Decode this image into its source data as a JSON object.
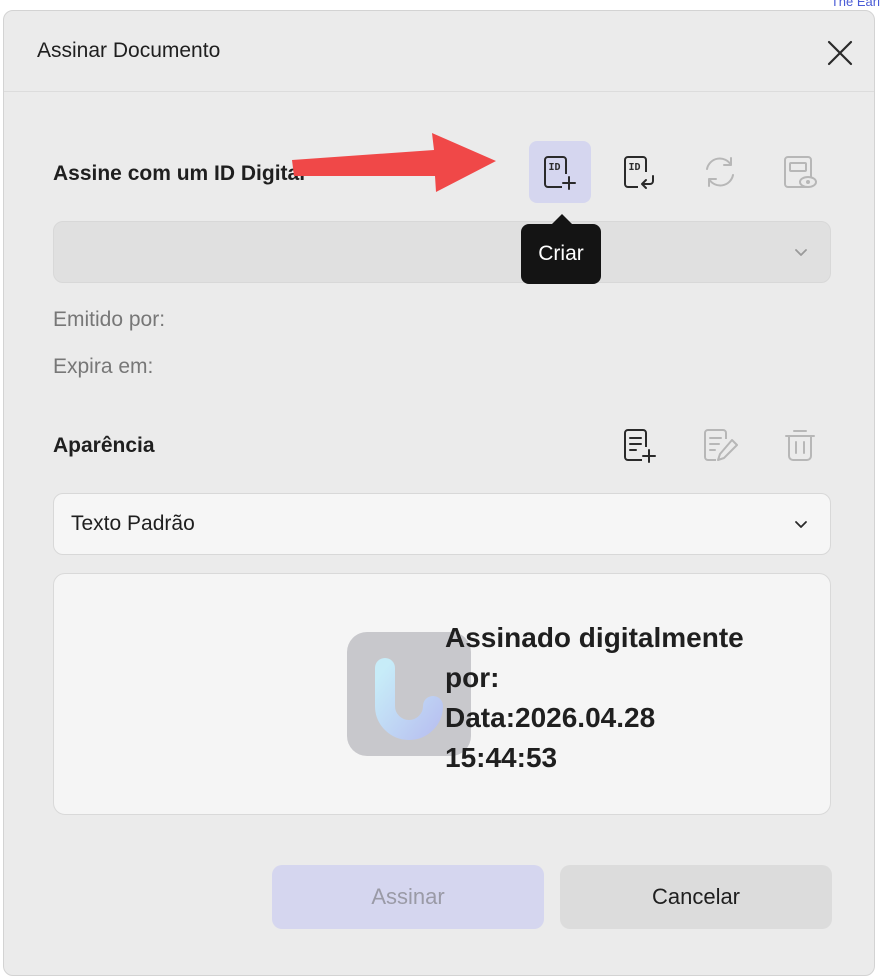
{
  "background": {
    "corner_link": "The Earl"
  },
  "dialog": {
    "title": "Assinar Documento",
    "digital_id": {
      "label": "Assine com um ID Digital",
      "select_value": "",
      "issued_by_label": "Emitido por:",
      "expires_label": "Expira em:",
      "tooltip": "Criar"
    },
    "appearance": {
      "label": "Aparência",
      "select_value": "Texto Padrão",
      "preview_lines": [
        "Assinado digitalmente",
        "por:",
        "Data:2026.04.28",
        "15:44:53"
      ]
    },
    "buttons": {
      "sign": "Assinar",
      "cancel": "Cancelar"
    }
  },
  "colors": {
    "accent_soft": "#d5d6ef",
    "annotation_arrow": "#f04848",
    "tooltip_bg": "#141414"
  }
}
